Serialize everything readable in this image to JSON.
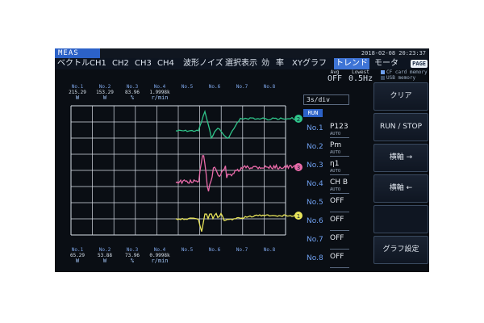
{
  "header": {
    "mode_tab": "MEAS",
    "datetime": "2018-02-08 20:23:37",
    "page_button": "PAGE"
  },
  "menu": [
    {
      "label": "ベクトル",
      "active": false
    },
    {
      "label": "CH1",
      "active": false
    },
    {
      "label": "CH2",
      "active": false
    },
    {
      "label": "CH3",
      "active": false
    },
    {
      "label": "CH4",
      "active": false
    },
    {
      "label": "波形ノイズ",
      "active": false
    },
    {
      "label": "選択表示",
      "active": false
    },
    {
      "label": "効",
      "active": false
    },
    {
      "label": "率",
      "active": false
    },
    {
      "label": "XYグラフ",
      "active": false
    },
    {
      "label": "トレンド",
      "active": true
    },
    {
      "label": "モータ",
      "active": false
    }
  ],
  "status": {
    "avg_label": "Avg",
    "avg_value": "OFF",
    "lowest_label": "Lowest",
    "lowest_value": "0.5Hz",
    "memory_cf": "CF card memory",
    "memory_usb": "USB memory"
  },
  "top_channels": [
    {
      "no": "No.1",
      "value": "215.29",
      "unit": "W"
    },
    {
      "no": "No.2",
      "value": "153.29",
      "unit": "W"
    },
    {
      "no": "No.3",
      "value": "83.96",
      "unit": "%"
    },
    {
      "no": "No.4",
      "value": "1.9998k",
      "unit": "r/min"
    },
    {
      "no": "No.5",
      "value": "",
      "unit": ""
    },
    {
      "no": "No.6",
      "value": "",
      "unit": ""
    },
    {
      "no": "No.7",
      "value": "",
      "unit": ""
    },
    {
      "no": "No.8",
      "value": "",
      "unit": ""
    }
  ],
  "bottom_channels": [
    {
      "no": "No.1",
      "value": "65.29",
      "unit": "W"
    },
    {
      "no": "No.2",
      "value": "53.88",
      "unit": "W"
    },
    {
      "no": "No.3",
      "value": "73.96",
      "unit": "%"
    },
    {
      "no": "No.4",
      "value": "0.9998k",
      "unit": "r/min"
    },
    {
      "no": "No.5",
      "value": "",
      "unit": ""
    },
    {
      "no": "No.6",
      "value": "",
      "unit": ""
    },
    {
      "no": "No.7",
      "value": "",
      "unit": ""
    },
    {
      "no": "No.8",
      "value": "",
      "unit": ""
    }
  ],
  "time_div": "3s/div",
  "run_badge": "RUN",
  "channel_list": [
    {
      "no": "No.1",
      "signal": "P123",
      "mode": "AUTO"
    },
    {
      "no": "No.2",
      "signal": "Pm",
      "mode": "AUTO"
    },
    {
      "no": "No.3",
      "signal": "η1",
      "mode": "AUTO"
    },
    {
      "no": "No.4",
      "signal": "CH B",
      "mode": "AUTO"
    },
    {
      "no": "No.5",
      "signal": "OFF",
      "mode": ""
    },
    {
      "no": "No.6",
      "signal": "OFF",
      "mode": ""
    },
    {
      "no": "No.7",
      "signal": "OFF",
      "mode": ""
    },
    {
      "no": "No.8",
      "signal": "OFF",
      "mode": ""
    }
  ],
  "softkeys": {
    "clear": "クリア",
    "run_stop": "RUN / STOP",
    "h_right": "横軸 →",
    "h_left": "横軸 ←",
    "graph_settings": "グラフ設定"
  },
  "trace_markers": [
    "2",
    "3",
    "1"
  ],
  "colors": {
    "trace_green": "#2fc58a",
    "trace_pink": "#e86aa8",
    "trace_yellow": "#e8e45a",
    "grid": "#d7dde6",
    "accent_blue": "#3e74d6"
  }
}
